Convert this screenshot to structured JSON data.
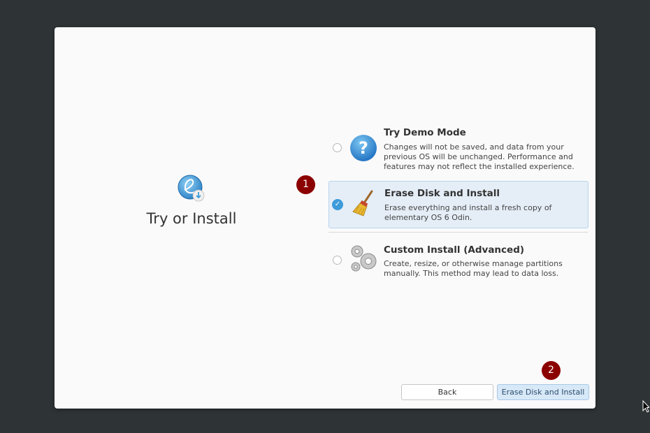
{
  "page": {
    "title": "Try or Install"
  },
  "options": [
    {
      "title": "Try Demo Mode",
      "description": "Changes will not be saved, and data from your previous OS will be unchanged. Performance and features may not reflect the installed experience.",
      "icon": "help-icon",
      "selected": false
    },
    {
      "title": "Erase Disk and Install",
      "description": "Erase everything and install a fresh copy of elementary OS 6 Odin.",
      "icon": "broom-icon",
      "selected": true
    },
    {
      "title": "Custom Install (Advanced)",
      "description": "Create, resize, or otherwise manage partitions manually. This method may lead to data loss.",
      "icon": "gears-icon",
      "selected": false
    }
  ],
  "markers": {
    "one": "1",
    "two": "2"
  },
  "buttons": {
    "back": "Back",
    "erase": "Erase Disk and Install"
  },
  "colors": {
    "accent": "#3d9bda",
    "marker": "#8b0000",
    "background": "#2e3436"
  }
}
